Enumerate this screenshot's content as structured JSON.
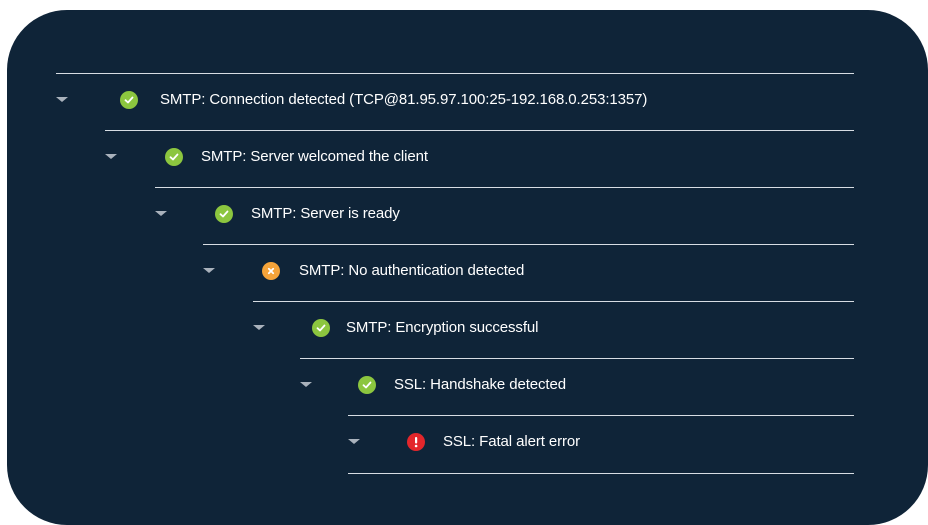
{
  "tree": {
    "items": [
      {
        "label": "SMTP: Connection detected (TCP@81.95.97.100:25-192.168.0.253:1357)",
        "status": "success",
        "icon": "check-circle-icon"
      },
      {
        "label": "SMTP: Server welcomed the client",
        "status": "success",
        "icon": "check-circle-icon"
      },
      {
        "label": "SMTP: Server is ready",
        "status": "success",
        "icon": "check-circle-icon"
      },
      {
        "label": "SMTP: No authentication detected",
        "status": "warning",
        "icon": "x-circle-icon"
      },
      {
        "label": "SMTP: Encryption successful",
        "status": "success",
        "icon": "check-circle-icon"
      },
      {
        "label": "SSL: Handshake detected",
        "status": "success",
        "icon": "check-circle-icon"
      },
      {
        "label": "SSL: Fatal alert error",
        "status": "error",
        "icon": "exclamation-circle-icon"
      }
    ]
  },
  "colors": {
    "background": "#0f2438",
    "success": "#8cc63f",
    "warning": "#f5a43a",
    "error": "#e3262b",
    "divider": "#d7dde3",
    "caret": "#a9b2bc"
  }
}
